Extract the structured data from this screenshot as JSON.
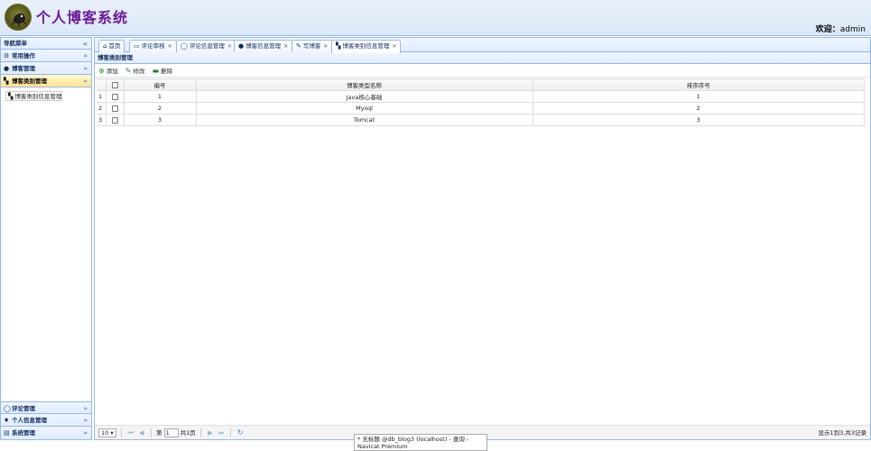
{
  "header": {
    "title": "个人博客系统",
    "welcome_label": "欢迎：",
    "username": "admin"
  },
  "sidebar": {
    "title": "导航菜单",
    "sections": [
      {
        "label": "常用操作",
        "icon": "gear-icon"
      },
      {
        "label": "博客管理",
        "icon": "blog-icon"
      },
      {
        "label": "博客类别管理",
        "icon": "category-icon"
      }
    ],
    "tree_item": "博客类别信息管理",
    "bottom_sections": [
      {
        "label": "评论管理",
        "icon": "comment-icon"
      },
      {
        "label": "个人信息管理",
        "icon": "user-icon"
      },
      {
        "label": "系统管理",
        "icon": "system-icon"
      }
    ]
  },
  "tabs": [
    {
      "label": "首页",
      "icon": "home-icon",
      "closable": false
    },
    {
      "label": "评论审核",
      "icon": "review-icon",
      "closable": true
    },
    {
      "label": "评论信息管理",
      "icon": "comment-icon",
      "closable": true
    },
    {
      "label": "博客信息管理",
      "icon": "blog-icon",
      "closable": true
    },
    {
      "label": "写博客",
      "icon": "write-icon",
      "closable": true
    },
    {
      "label": "博客类别信息管理",
      "icon": "category-icon",
      "closable": true,
      "active": true
    }
  ],
  "panel": {
    "title": "博客类别管理",
    "toolbar": {
      "add": "添加",
      "edit": "修改",
      "delete": "删除"
    }
  },
  "table": {
    "columns": [
      "编号",
      "博客类型名称",
      "排序序号"
    ],
    "rows": [
      {
        "num": "1",
        "id": "1",
        "name": "Java核心基础",
        "order": "1"
      },
      {
        "num": "2",
        "id": "2",
        "name": "Mysql",
        "order": "2"
      },
      {
        "num": "3",
        "id": "3",
        "name": "Tomcat",
        "order": "3"
      }
    ]
  },
  "pager": {
    "page_size": "10",
    "page_prefix": "第",
    "page_value": "1",
    "page_suffix": "共1页",
    "info": "显示1到3,共3记录"
  },
  "popup": {
    "text": "* 无标题 @db_blog3 (localhost) - 查询 - Navicat Premium"
  }
}
